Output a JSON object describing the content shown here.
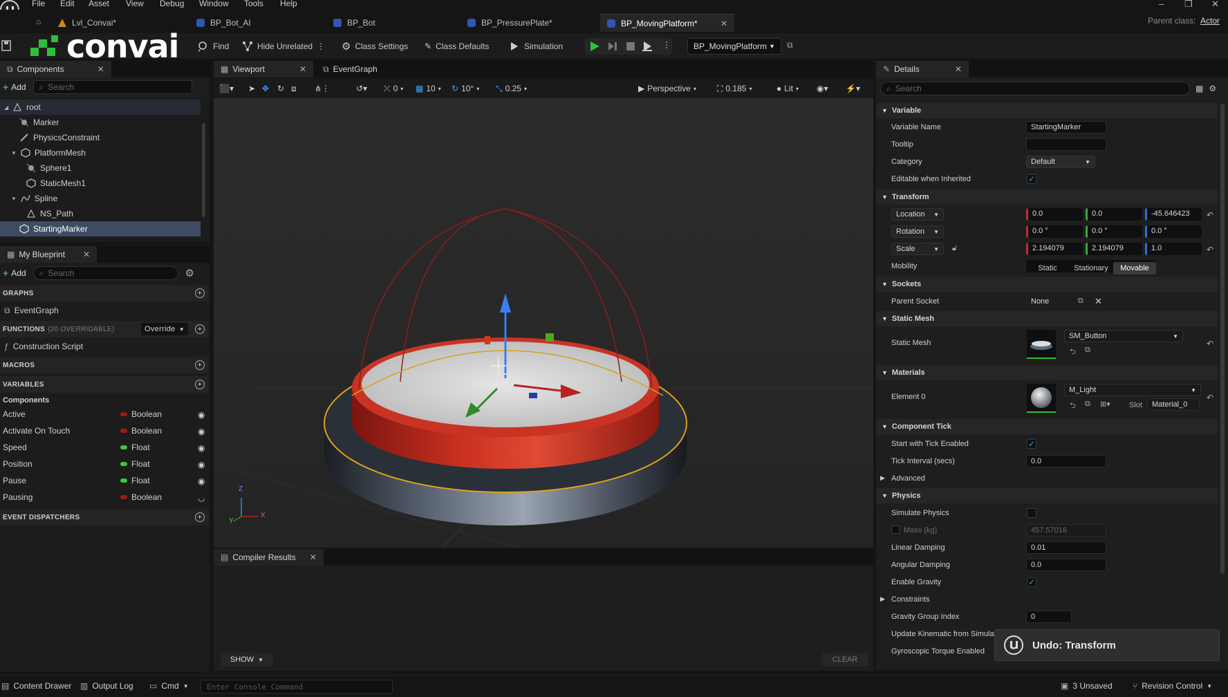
{
  "menu": {
    "items": [
      "File",
      "Edit",
      "Asset",
      "View",
      "Debug",
      "Window",
      "Tools",
      "Help"
    ]
  },
  "tabs": {
    "items": [
      {
        "label": "Lvl_Convai*"
      },
      {
        "label": "BP_Bot_AI"
      },
      {
        "label": "BP_Bot"
      },
      {
        "label": "BP_PressurePlate*"
      },
      {
        "label": "BP_MovingPlatform*"
      }
    ],
    "parent_class_label": "Parent class:",
    "parent_class_value": "Actor"
  },
  "toolbar": {
    "logo_text": "convai",
    "find": "Find",
    "hide_unrelated": "Hide Unrelated",
    "class_settings": "Class Settings",
    "class_defaults": "Class Defaults",
    "simulation": "Simulation",
    "debug_object": "BP_MovingPlatform"
  },
  "components": {
    "tab_label": "Components",
    "add_label": "Add",
    "search_placeholder": "Search",
    "tree": [
      {
        "label": "root",
        "icon": "scene-root-icon"
      },
      {
        "label": "Marker",
        "icon": "billboard-icon"
      },
      {
        "label": "PhysicsConstraint",
        "icon": "constraint-icon"
      },
      {
        "label": "PlatformMesh",
        "icon": "static-mesh-icon"
      },
      {
        "label": "Sphere1",
        "icon": "billboard-icon"
      },
      {
        "label": "StaticMesh1",
        "icon": "static-mesh-icon"
      },
      {
        "label": "Spline",
        "icon": "spline-icon"
      },
      {
        "label": "NS_Path",
        "icon": "niagara-icon"
      },
      {
        "label": "StartingMarker",
        "icon": "static-mesh-icon"
      }
    ]
  },
  "my_blueprint": {
    "tab_label": "My Blueprint",
    "add_label": "Add",
    "search_placeholder": "Search",
    "graphs_header": "GRAPHS",
    "graph_item": "EventGraph",
    "functions_header": "FUNCTIONS",
    "functions_count": "(20 OVERRIDABLE)",
    "override_label": "Override",
    "function_item": "Construction Script",
    "macros_header": "MACROS",
    "variables_header": "VARIABLES",
    "variables_group": "Components",
    "variables": [
      {
        "name": "Active",
        "type": "Boolean",
        "color": "#9b1b1b"
      },
      {
        "name": "Activate On Touch",
        "type": "Boolean",
        "color": "#9b1b1b"
      },
      {
        "name": "Speed",
        "type": "Float",
        "color": "#38c938"
      },
      {
        "name": "Position",
        "type": "Float",
        "color": "#38c938"
      },
      {
        "name": "Pause",
        "type": "Float",
        "color": "#38c938"
      },
      {
        "name": "Pausing",
        "type": "Boolean",
        "color": "#9b1b1b"
      }
    ],
    "dispatchers_header": "EVENT DISPATCHERS"
  },
  "viewport": {
    "tab_viewport": "Viewport",
    "tab_eventgraph": "EventGraph",
    "translate_snap": "0",
    "grid_snap": "10",
    "rotation_snap": "10°",
    "scale_snap": "0.25",
    "perspective": "Perspective",
    "camera_speed": "0.185",
    "view_mode": "Lit",
    "axis_z": "Z",
    "axis_y": "Y",
    "axis_x": "X"
  },
  "compiler": {
    "tab_label": "Compiler Results",
    "show_label": "SHOW",
    "clear_label": "CLEAR"
  },
  "details": {
    "tab_label": "Details",
    "search_placeholder": "Search",
    "variable": {
      "header": "Variable",
      "name_label": "Variable Name",
      "name_value": "StartingMarker",
      "tooltip_label": "Tooltip",
      "tooltip_value": "",
      "category_label": "Category",
      "category_value": "Default",
      "editable_label": "Editable when Inherited"
    },
    "transform": {
      "header": "Transform",
      "location_label": "Location",
      "location": [
        "0.0",
        "0.0",
        "-45.646423"
      ],
      "rotation_label": "Rotation",
      "rotation": [
        "0.0 °",
        "0.0 °",
        "0.0 °"
      ],
      "scale_label": "Scale",
      "scale": [
        "2.194079",
        "2.194079",
        "1.0"
      ],
      "mobility_label": "Mobility",
      "mobility_options": [
        "Static",
        "Stationary",
        "Movable"
      ]
    },
    "sockets": {
      "header": "Sockets",
      "parent_label": "Parent Socket",
      "parent_value": "None"
    },
    "static_mesh": {
      "header": "Static Mesh",
      "label": "Static Mesh",
      "value": "SM_Button"
    },
    "materials": {
      "header": "Materials",
      "element_label": "Element 0",
      "value": "M_Light",
      "slot_label": "Slot",
      "slot_value": "Material_0"
    },
    "component_tick": {
      "header": "Component Tick",
      "start_label": "Start with Tick Enabled",
      "interval_label": "Tick Interval (secs)",
      "interval_value": "0.0",
      "advanced_label": "Advanced"
    },
    "physics": {
      "header": "Physics",
      "simulate_label": "Simulate Physics",
      "mass_label": "Mass (kg)",
      "mass_value": "457.57016",
      "linear_label": "Linear Damping",
      "linear_value": "0.01",
      "angular_label": "Angular Damping",
      "angular_value": "0.0",
      "gravity_label": "Enable Gravity",
      "constraints_label": "Constraints",
      "gravity_group_label": "Gravity Group Index",
      "gravity_group_value": "0",
      "kinematic_label": "Update Kinematic from Simulat",
      "gyro_label": "Gyroscopic Torque Enabled"
    }
  },
  "toast": {
    "text": "Undo: Transform"
  },
  "statusbar": {
    "content_drawer": "Content Drawer",
    "output_log": "Output Log",
    "cmd": "Cmd",
    "console_placeholder": "Enter Console Command",
    "unsaved": "3 Unsaved",
    "revision_control": "Revision Control"
  }
}
